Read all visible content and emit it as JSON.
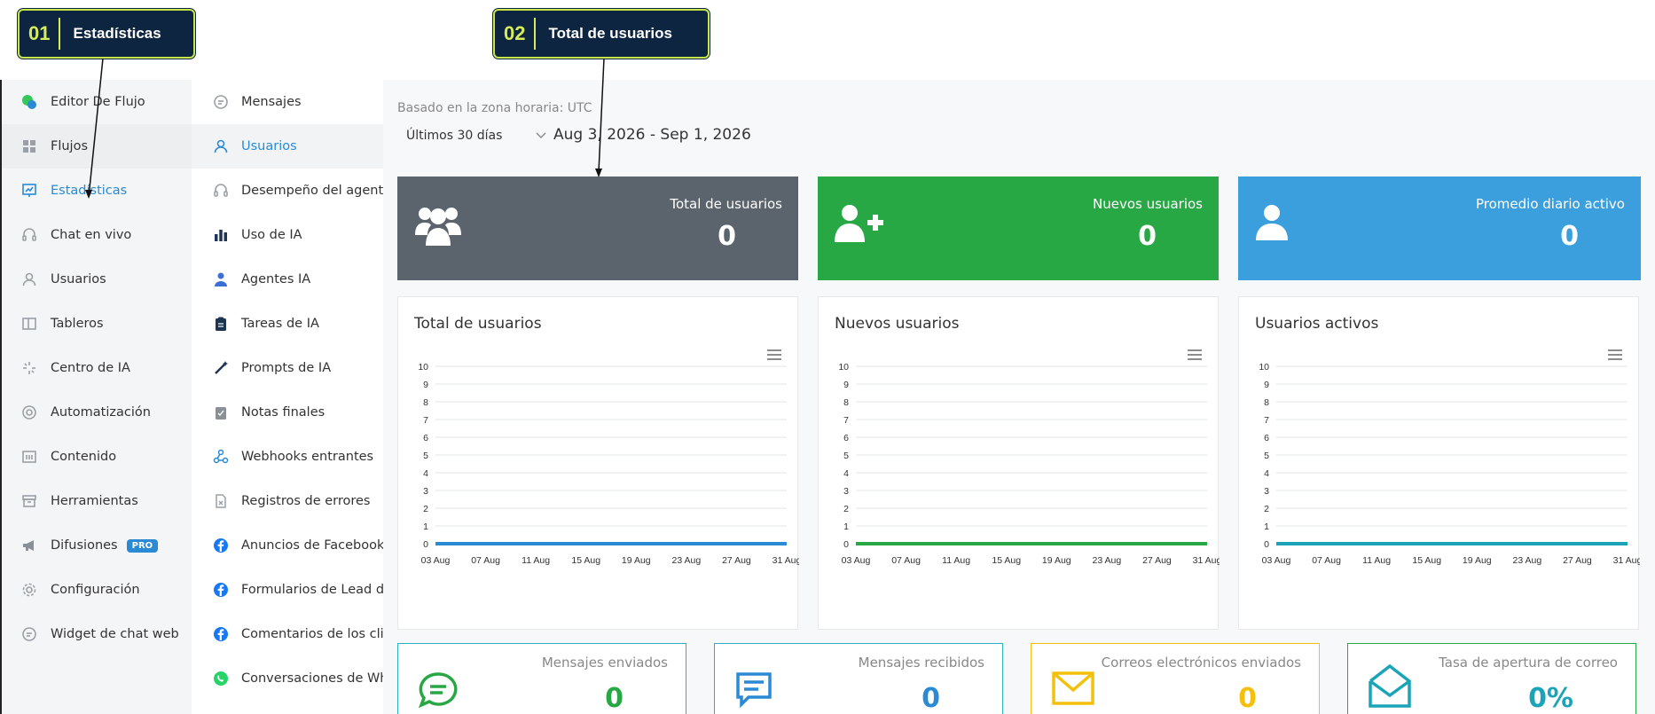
{
  "callouts": [
    {
      "num": "01",
      "text": "Estadísticas"
    },
    {
      "num": "02",
      "text": "Total de usuarios"
    }
  ],
  "sidebar": {
    "items": [
      {
        "label": "Editor De Flujo",
        "icon": "flow-editor-icon"
      },
      {
        "label": "Flujos",
        "icon": "grid-icon"
      },
      {
        "label": "Estadísticas",
        "icon": "chart-board-icon"
      },
      {
        "label": "Chat en vivo",
        "icon": "headset-icon"
      },
      {
        "label": "Usuarios",
        "icon": "user-icon"
      },
      {
        "label": "Tableros",
        "icon": "board-icon"
      },
      {
        "label": "Centro de IA",
        "icon": "sparkle-icon"
      },
      {
        "label": "Automatización",
        "icon": "cog-circle-icon"
      },
      {
        "label": "Contenido",
        "icon": "content-icon"
      },
      {
        "label": "Herramientas",
        "icon": "toolbox-icon"
      },
      {
        "label": "Difusiones",
        "icon": "megaphone-icon",
        "badge": "PRO"
      },
      {
        "label": "Configuración",
        "icon": "gear-icon"
      },
      {
        "label": "Widget de chat web",
        "icon": "chat-bubble-icon"
      }
    ]
  },
  "subnav": {
    "items": [
      {
        "label": "Mensajes",
        "icon": "message-icon"
      },
      {
        "label": "Usuarios",
        "icon": "user-icon"
      },
      {
        "label": "Desempeño del agente",
        "icon": "headset-icon"
      },
      {
        "label": "Uso de IA",
        "icon": "bar-chart-icon"
      },
      {
        "label": "Agentes IA",
        "icon": "agent-icon"
      },
      {
        "label": "Tareas de IA",
        "icon": "clipboard-icon"
      },
      {
        "label": "Prompts de IA",
        "icon": "magic-wand-icon"
      },
      {
        "label": "Notas finales",
        "icon": "notes-icon"
      },
      {
        "label": "Webhooks entrantes",
        "icon": "webhook-icon"
      },
      {
        "label": "Registros de errores",
        "icon": "error-log-icon"
      },
      {
        "label": "Anuncios de Facebook",
        "icon": "facebook-icon"
      },
      {
        "label": "Formularios de Lead de F",
        "icon": "facebook-icon"
      },
      {
        "label": "Comentarios de los client",
        "icon": "facebook-icon"
      },
      {
        "label": "Conversaciones de Whats",
        "icon": "whatsapp-icon"
      }
    ]
  },
  "main": {
    "timezone": "Basado en la zona horaria: UTC",
    "range_select": "Últimos 30 días",
    "range_dates": "Aug 3, 2026 - Sep 1, 2026",
    "stats": [
      {
        "label": "Total de usuarios",
        "value": "0",
        "color": "#5b646c"
      },
      {
        "label": "Nuevos usuarios",
        "value": "0",
        "color": "#28a745"
      },
      {
        "label": "Promedio diario activo",
        "value": "0",
        "color": "#3a9fdc"
      }
    ],
    "mini_cards": [
      {
        "label": "Mensajes enviados",
        "value": "0",
        "color": "#28a745",
        "border": "#2bb0c0"
      },
      {
        "label": "Mensajes recibidos",
        "value": "0",
        "color": "#2a8ad4",
        "border": "#2bb0c0"
      },
      {
        "label": "Correos electrónicos enviados",
        "value": "0",
        "color": "#f3c10d",
        "border": "#f3c10d"
      },
      {
        "label": "Tasa de apertura de correo",
        "value": "0%",
        "color": "#1ba4b8",
        "border": "#28a745"
      }
    ]
  },
  "chart_data": [
    {
      "type": "line",
      "title": "Total de usuarios",
      "color": "#2a8ad4",
      "categories": [
        "03 Aug",
        "07 Aug",
        "11 Aug",
        "15 Aug",
        "19 Aug",
        "23 Aug",
        "27 Aug",
        "31 Aug"
      ],
      "yticks": [
        "0",
        "1",
        "2",
        "3",
        "4",
        "5",
        "6",
        "7",
        "8",
        "9",
        "10"
      ],
      "ylim": [
        0,
        10
      ],
      "values": [
        0,
        0,
        0,
        0,
        0,
        0,
        0,
        0
      ]
    },
    {
      "type": "line",
      "title": "Nuevos usuarios",
      "color": "#28a745",
      "categories": [
        "03 Aug",
        "07 Aug",
        "11 Aug",
        "15 Aug",
        "19 Aug",
        "23 Aug",
        "27 Aug",
        "31 Aug"
      ],
      "yticks": [
        "0",
        "1",
        "2",
        "3",
        "4",
        "5",
        "6",
        "7",
        "8",
        "9",
        "10"
      ],
      "ylim": [
        0,
        10
      ],
      "values": [
        0,
        0,
        0,
        0,
        0,
        0,
        0,
        0
      ]
    },
    {
      "type": "line",
      "title": "Usuarios activos",
      "color": "#1ba4b8",
      "categories": [
        "03 Aug",
        "07 Aug",
        "11 Aug",
        "15 Aug",
        "19 Aug",
        "23 Aug",
        "27 Aug",
        "31 Aug"
      ],
      "yticks": [
        "0",
        "1",
        "2",
        "3",
        "4",
        "5",
        "6",
        "7",
        "8",
        "9",
        "10"
      ],
      "ylim": [
        0,
        10
      ],
      "values": [
        0,
        0,
        0,
        0,
        0,
        0,
        0,
        0
      ]
    }
  ]
}
